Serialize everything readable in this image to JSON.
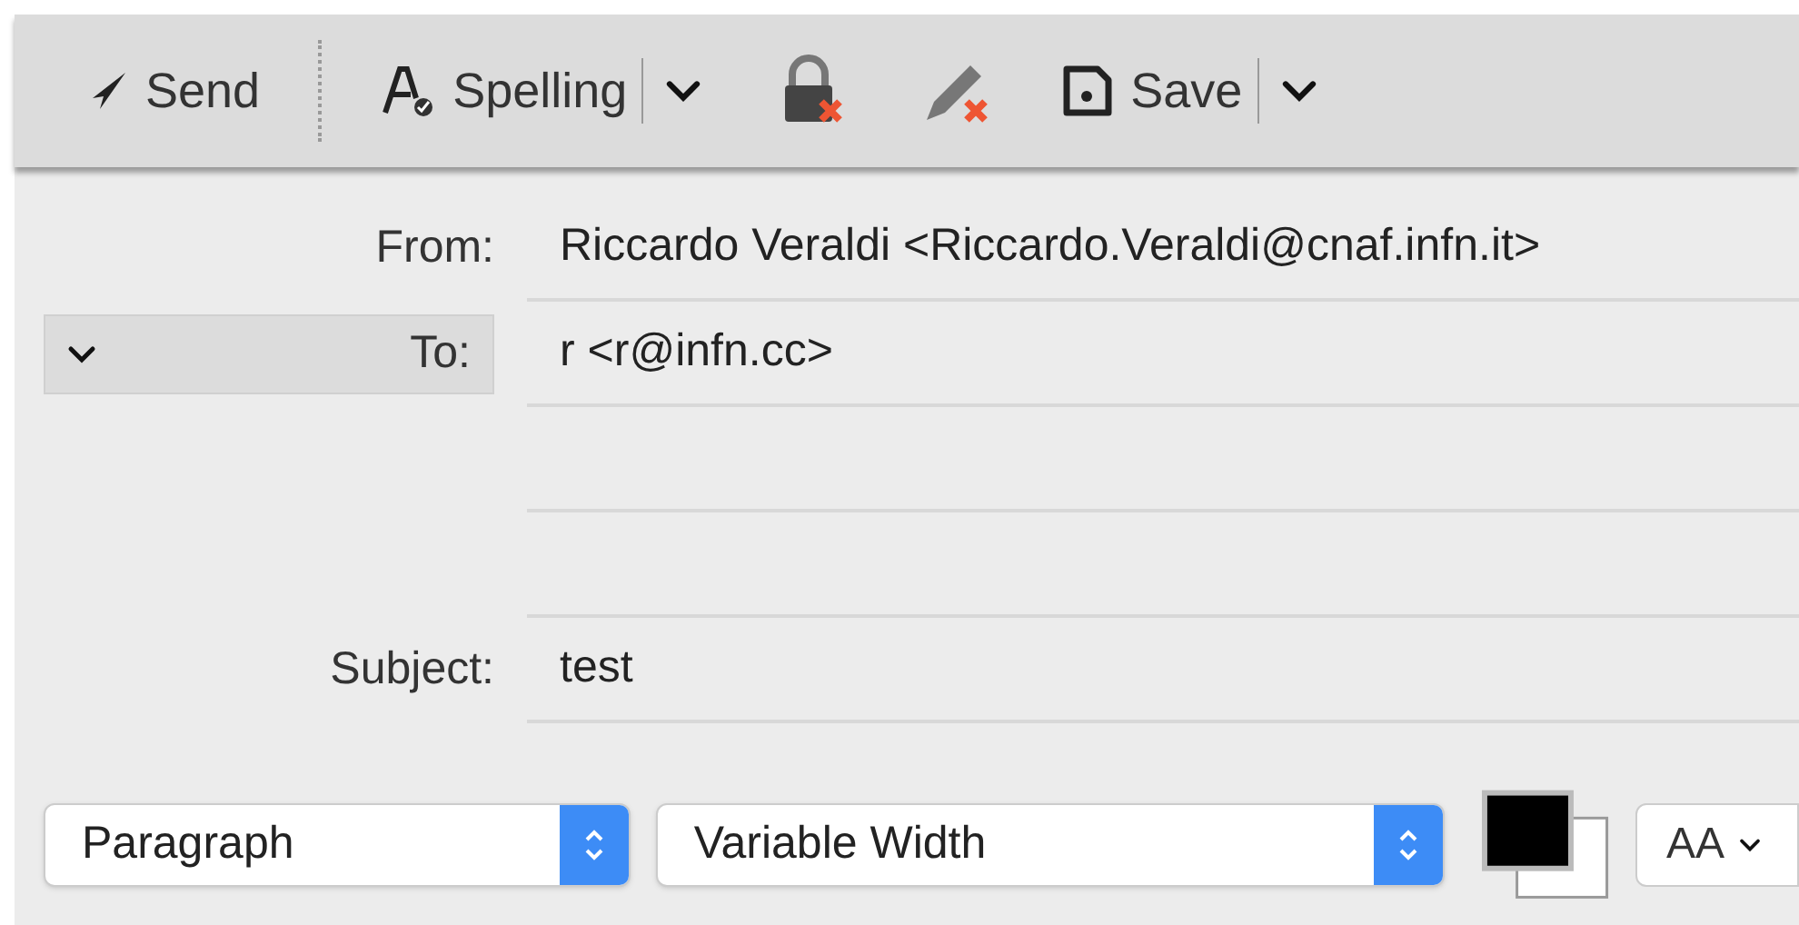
{
  "toolbar": {
    "items": [
      {
        "kind": "send",
        "label": "Send"
      },
      {
        "kind": "spelling",
        "label": "Spelling"
      },
      {
        "kind": "encrypt"
      },
      {
        "kind": "sign"
      },
      {
        "kind": "save",
        "label": "Save"
      }
    ]
  },
  "header_fields": [
    {
      "kind": "plain",
      "label": "From:",
      "value": "Riccardo Veraldi <Riccardo.Veraldi@cnaf.infn.it>"
    },
    {
      "kind": "recipients",
      "label": "To:",
      "value": "r <r@infn.cc>"
    },
    {
      "kind": "plain"
    },
    {
      "kind": "plain"
    },
    {
      "kind": "plain",
      "label": "Subject:",
      "value": "test"
    }
  ],
  "format_bar": {
    "paragraph_style": "Paragraph",
    "font": "Variable Width",
    "font_size_button": "AA"
  }
}
